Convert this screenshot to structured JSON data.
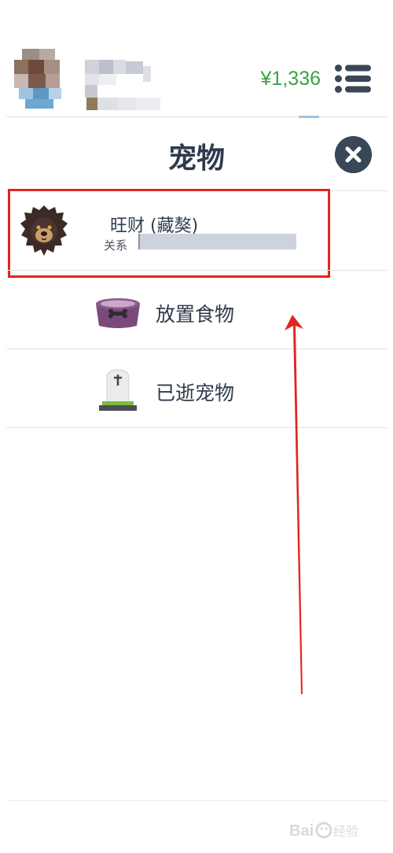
{
  "header": {
    "balance": "¥1,336"
  },
  "page": {
    "title": "宠物"
  },
  "pet": {
    "name": "旺财 (藏獒)",
    "relation_label": "关系"
  },
  "menu": {
    "items": [
      {
        "label": "放置食物",
        "icon": "pet-bowl-icon"
      },
      {
        "label": "已逝宠物",
        "icon": "tombstone-icon"
      }
    ]
  },
  "colors": {
    "balance": "#3aa142",
    "highlight": "#e2241f",
    "text": "#2f3b4c",
    "close_button": "#3a4756"
  }
}
